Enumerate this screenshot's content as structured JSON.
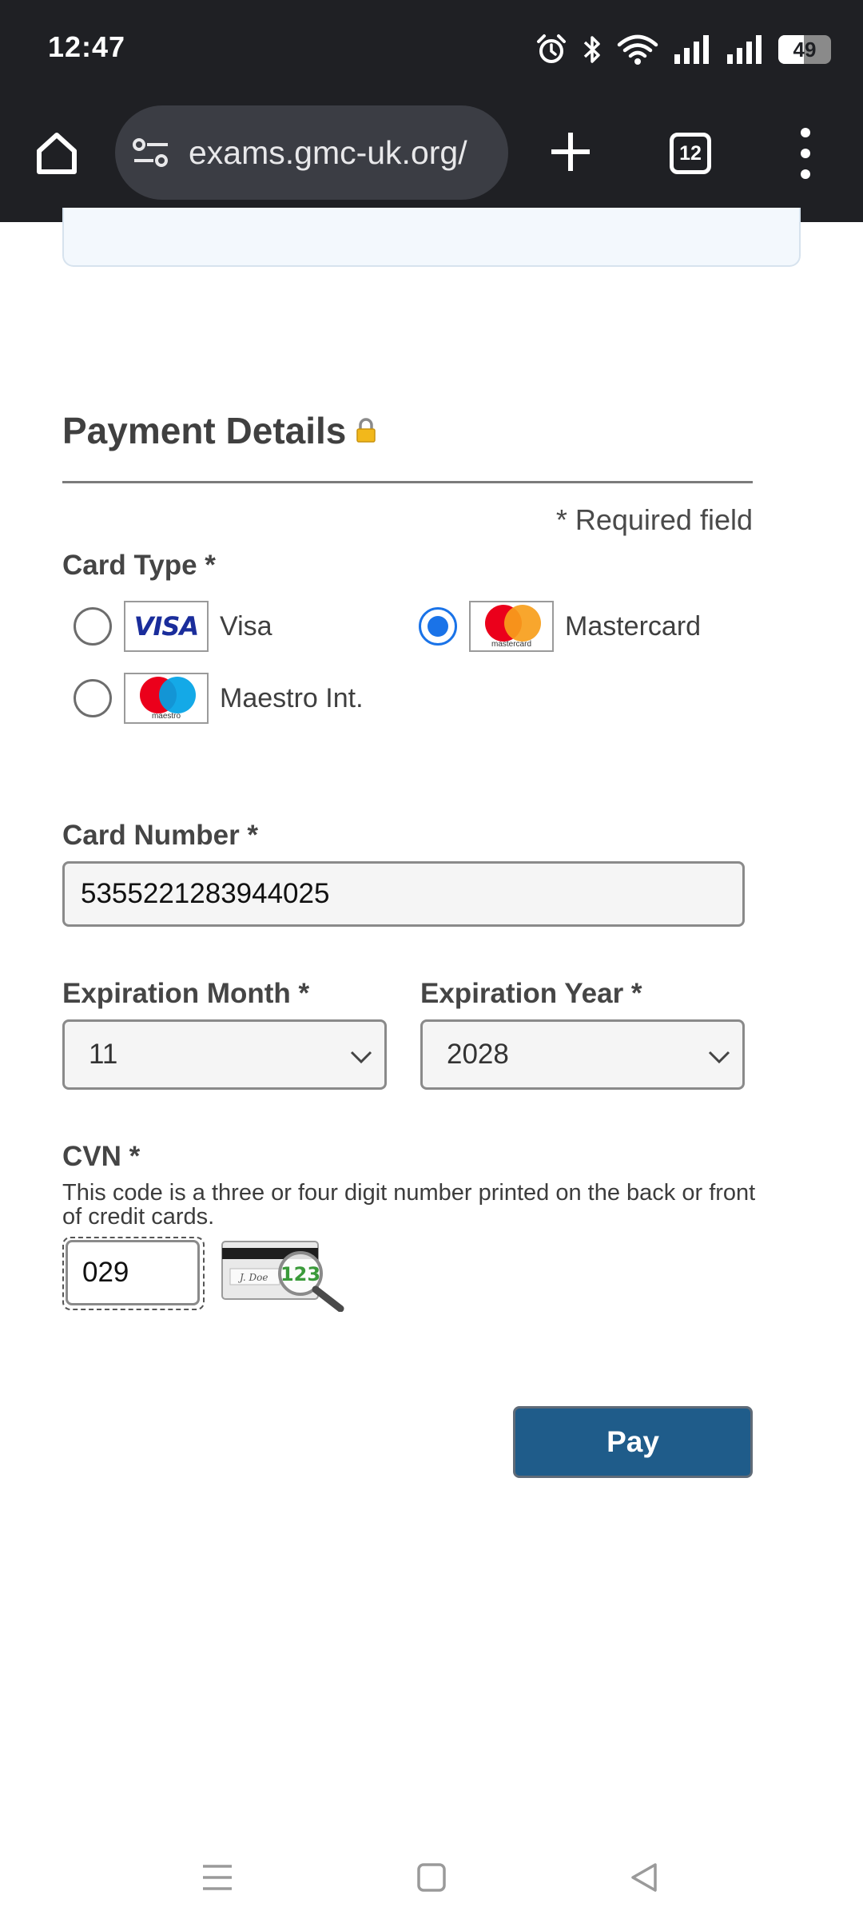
{
  "status_bar": {
    "time": "12:47",
    "battery_level": "49",
    "icons": [
      "alarm-icon",
      "bluetooth-icon",
      "wifi-icon",
      "signal-icon",
      "signal-icon",
      "battery-icon"
    ]
  },
  "browser": {
    "url": "exams.gmc-uk.org/",
    "tab_count": "12",
    "icons": [
      "home-icon",
      "site-settings-icon",
      "new-tab-icon",
      "tab-switcher-icon",
      "more-menu-icon"
    ]
  },
  "payment": {
    "title": "Payment Details",
    "required_note": "* Required field",
    "card_type_label": "Card Type *",
    "card_options": [
      {
        "name": "Visa",
        "logo_text": "VISA",
        "selected": false
      },
      {
        "name": "Mastercard",
        "logo_text": "mastercard",
        "selected": true
      },
      {
        "name": "Maestro Int.",
        "logo_text": "maestro",
        "selected": false
      }
    ],
    "card_number_label": "Card Number *",
    "card_number_value": "5355221283944025",
    "exp_month_label": "Expiration Month *",
    "exp_month_value": "11",
    "exp_year_label": "Expiration Year *",
    "exp_year_value": "2028",
    "cvn_label": "CVN *",
    "cvn_help": "This code is a three or four digit number printed on the back or front of credit cards.",
    "cvn_value": "029",
    "cvn_image_text": "123",
    "cvn_image_signature": "J. Doe",
    "pay_label": "Pay"
  },
  "colors": {
    "accent_blue": "#1a73e8",
    "pay_button": "#1f5c8a",
    "chrome_dark": "#1f2024"
  },
  "nav_bar": {
    "icons": [
      "recent-apps-icon",
      "home-nav-icon",
      "back-icon"
    ]
  }
}
